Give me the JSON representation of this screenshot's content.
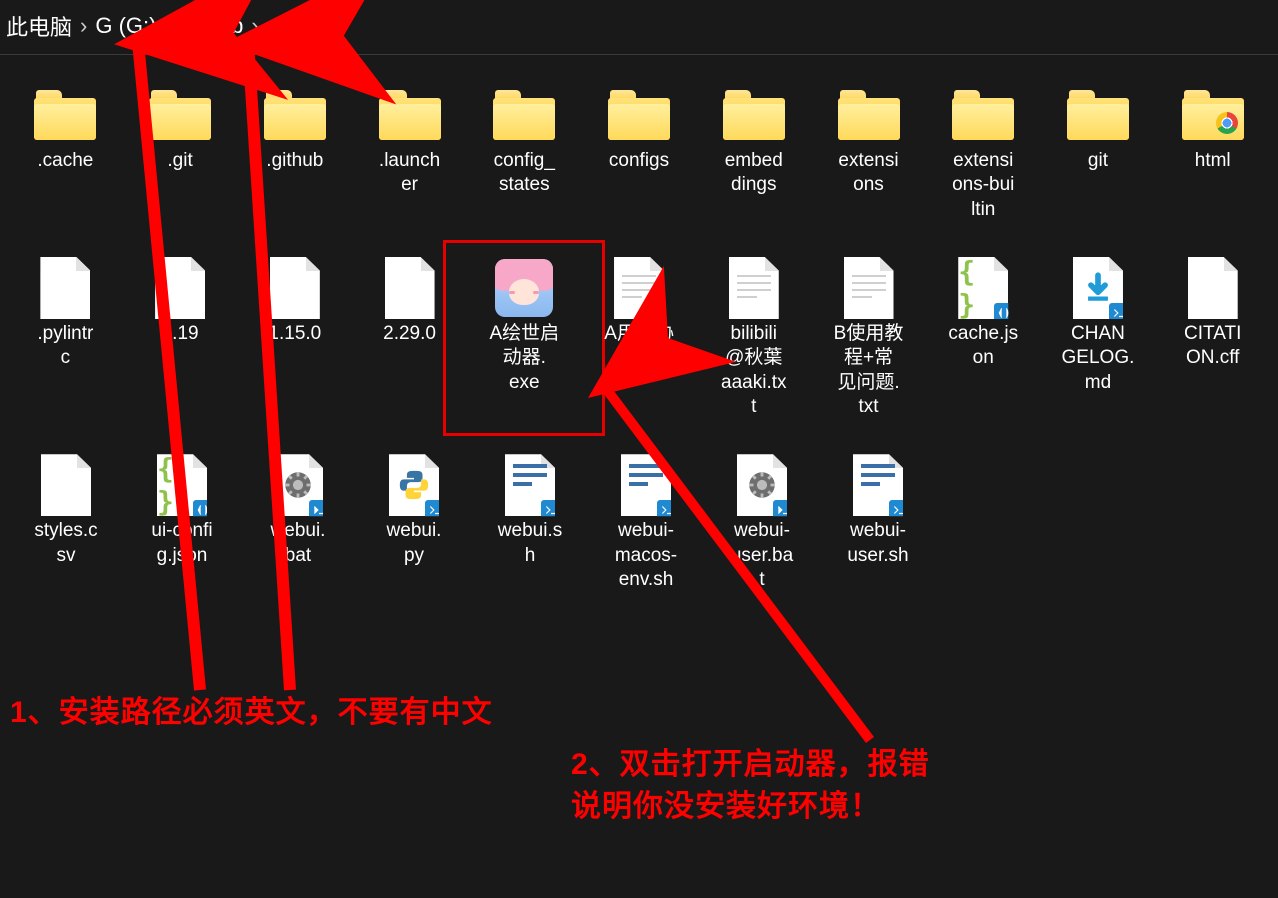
{
  "breadcrumb": {
    "segments": [
      "此电脑",
      "G (G:)",
      "sdweb"
    ],
    "separator": "›"
  },
  "rows": [
    [
      {
        "type": "folder",
        "label": ".cache"
      },
      {
        "type": "folder",
        "label": ".git"
      },
      {
        "type": "folder",
        "label": ".github"
      },
      {
        "type": "folder",
        "label": ".launch\ner"
      },
      {
        "type": "folder",
        "label": "config_\nstates"
      },
      {
        "type": "folder",
        "label": "configs"
      },
      {
        "type": "folder",
        "label": "embed\ndings"
      },
      {
        "type": "folder",
        "label": "extensi\nons"
      },
      {
        "type": "folder",
        "label": "extensi\nons-bui\nltin"
      },
      {
        "type": "folder",
        "label": "git"
      },
      {
        "type": "folder-chrome",
        "label": "html"
      }
    ],
    [
      {
        "type": "file-blank",
        "label": ".pylintr\nc"
      },
      {
        "type": "file-blank",
        "label": "0.19"
      },
      {
        "type": "file-blank",
        "label": "1.15.0"
      },
      {
        "type": "file-blank",
        "label": "2.29.0"
      },
      {
        "type": "anime",
        "label": "A绘世启\n动器.\nexe",
        "highlight": true
      },
      {
        "type": "file-txt",
        "label": "A用户协\n议.txt"
      },
      {
        "type": "file-txt",
        "label": "bilibili\n@秋葉\naaaki.tx\nt"
      },
      {
        "type": "file-txt",
        "label": "B使用教\n程+常\n见问题.\ntxt"
      },
      {
        "type": "file-json",
        "label": "cache.js\non"
      },
      {
        "type": "file-md",
        "label": "CHAN\nGELOG.\nmd"
      },
      {
        "type": "file-blank",
        "label": "CITATI\nON.cff"
      }
    ],
    [
      {
        "type": "file-blank",
        "label": "styles.c\nsv"
      },
      {
        "type": "file-json",
        "label": "ui-confi\ng.json"
      },
      {
        "type": "file-bat",
        "label": "webui.\nbat"
      },
      {
        "type": "file-py",
        "label": "webui.\npy"
      },
      {
        "type": "file-sh",
        "label": "webui.s\nh"
      },
      {
        "type": "file-sh",
        "label": "webui-\nmacos-\nenv.sh"
      },
      {
        "type": "file-bat",
        "label": "webui-\nuser.ba\nt"
      },
      {
        "type": "file-sh",
        "label": "webui-\nuser.sh"
      }
    ]
  ],
  "annotations": {
    "text1": "1、安装路径必须英文，不要有中文",
    "text2": "2、双击打开启动器，报错\n说明你没安装好环境！",
    "color": "#fe0000"
  }
}
